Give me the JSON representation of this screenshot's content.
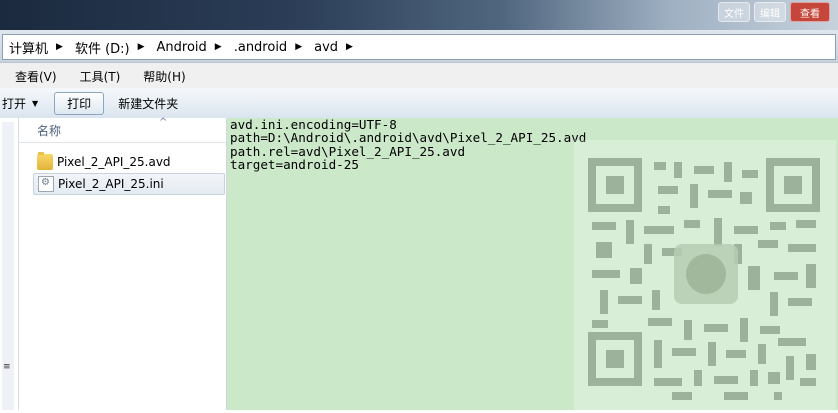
{
  "window": {
    "buttons": [
      {
        "label": "文件"
      },
      {
        "label": "编辑"
      },
      {
        "label": "查看"
      }
    ]
  },
  "breadcrumb": [
    "计算机",
    "软件 (D:)",
    "Android",
    ".android",
    "avd"
  ],
  "menu": [
    "查看(V)",
    "工具(T)",
    "帮助(H)"
  ],
  "toolbar": {
    "open_label": "打开",
    "print_label": "打印",
    "new_folder_label": "新建文件夹"
  },
  "filelist": {
    "column_name": "名称",
    "files": [
      {
        "name": "Pixel_2_API_25.avd",
        "type": "folder"
      },
      {
        "name": "Pixel_2_API_25.ini",
        "type": "ini"
      }
    ]
  },
  "preview": {
    "lines": [
      "avd.ini.encoding=UTF-8",
      "path=D:\\Android\\.android\\avd\\Pixel_2_API_25.avd",
      "path.rel=avd\\Pixel_2_API_25.avd",
      "target=android-25"
    ]
  },
  "colors": {
    "preview_bg": "#cbe8c9",
    "qr_module": "#8a9f86"
  }
}
